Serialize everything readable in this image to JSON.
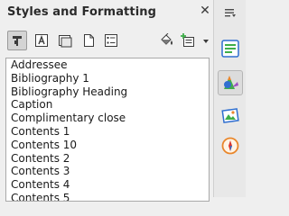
{
  "panel": {
    "title": "Styles and Formatting",
    "close_glyph": "✕"
  },
  "toolbar": {
    "buttons": [
      {
        "name": "paragraph-styles-icon",
        "active": true
      },
      {
        "name": "character-styles-icon",
        "active": false
      },
      {
        "name": "frame-styles-icon",
        "active": false
      },
      {
        "name": "page-styles-icon",
        "active": false
      },
      {
        "name": "list-styles-icon",
        "active": false
      }
    ],
    "right_buttons": [
      "fill-format-mode-icon",
      "new-style-icon"
    ]
  },
  "styles_list": [
    "Addressee",
    "Bibliography 1",
    "Bibliography Heading",
    "Caption",
    "Complimentary close",
    "Contents 1",
    "Contents 10",
    "Contents 2",
    "Contents 3",
    "Contents 4",
    "Contents 5"
  ],
  "sidebar": {
    "menu_icon": "sidebar-menu-icon",
    "tabs": [
      "properties-icon",
      "styles-icon",
      "gallery-icon",
      "navigator-icon"
    ],
    "active_tab": "styles-icon"
  },
  "colors": {
    "accent_green": "#3fae49",
    "accent_blue": "#2f6fd0",
    "accent_orange": "#e9862b"
  }
}
